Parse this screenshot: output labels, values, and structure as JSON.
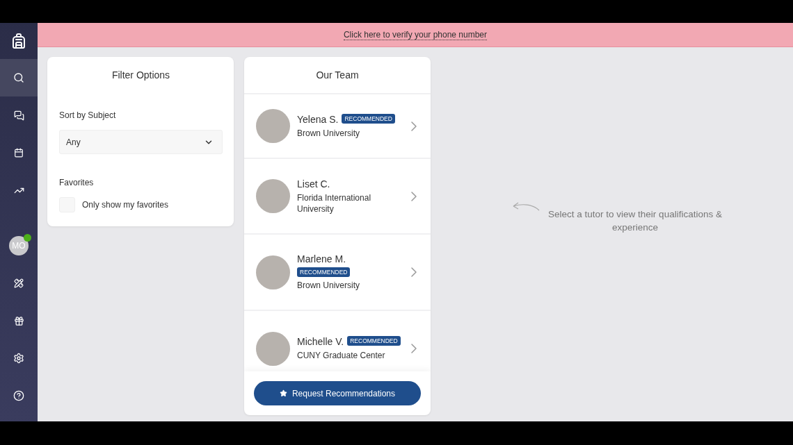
{
  "sidebar": {
    "items": [
      {
        "kind": "search",
        "selected": true
      },
      {
        "kind": "chat",
        "selected": false
      },
      {
        "kind": "calendar",
        "selected": false
      },
      {
        "kind": "progress",
        "selected": false
      },
      {
        "kind": "avatar",
        "initials": "MO",
        "online": true
      },
      {
        "kind": "subjects",
        "selected": false
      },
      {
        "kind": "gift",
        "selected": false
      },
      {
        "kind": "settings",
        "selected": false
      },
      {
        "kind": "help",
        "selected": false
      }
    ]
  },
  "banner": {
    "link": "Click here to verify your phone number"
  },
  "filter": {
    "title": "Filter Options",
    "sort_label": "Sort by Subject",
    "sort_value": "Any",
    "favorites_label": "Favorites",
    "favorites_option": "Only show my favorites",
    "favorites_checked": false
  },
  "team": {
    "title": "Our Team",
    "tutors": [
      {
        "kind": "inline",
        "name": "Yelena S.",
        "badge": "RECOMMENDED",
        "school": "Brown University"
      },
      {
        "kind": "inline",
        "name": "Liset C.",
        "school": "Florida International University"
      },
      {
        "kind": "stacked",
        "name": "Marlene M.",
        "badge": "RECOMMENDED",
        "school": "Brown University"
      },
      {
        "kind": "inline",
        "name": "Michelle V.",
        "badge": "RECOMMENDED",
        "school": "CUNY Graduate Center"
      }
    ],
    "button": "Request Recommendations"
  },
  "hint": {
    "text": "Select a tutor to view their qualifications & experience"
  }
}
